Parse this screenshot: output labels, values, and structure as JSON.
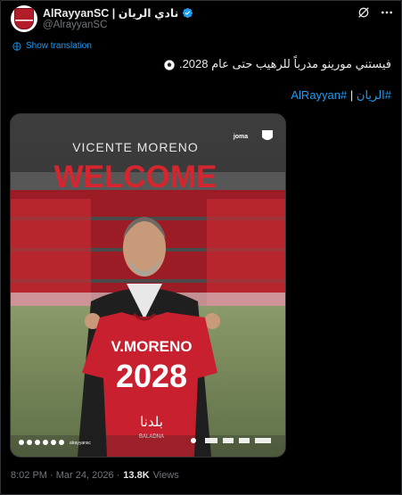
{
  "header": {
    "display_name": "AlRayyanSC | نادي الريان",
    "handle": "@AlrayyanSC"
  },
  "tweet": {
    "translate_label": "Show translation",
    "text": "فيستني مورينو مدرباً للرهيب حتى عام 2028.",
    "hashtag_1": "#الريان",
    "separator": "|",
    "hashtag_2": "#AlRayyan"
  },
  "media": {
    "top_name": "VICENTE MORENO",
    "brand_joma": "joma",
    "headline": "WELCOME",
    "jersey_name": "V.MORENO",
    "jersey_number": "2028",
    "sponsor_arabic": "بلدنا",
    "sponsor_latin": "BALADNA",
    "social_handle": "alrayyansc"
  },
  "footer": {
    "timestamp": "8:02 PM · Mar 24, 2026 ·",
    "views_count": "13.8K",
    "views_label": "Views"
  },
  "colors": {
    "link": "#1d9bf0",
    "brand_red": "#c8202f",
    "background": "#000000"
  }
}
